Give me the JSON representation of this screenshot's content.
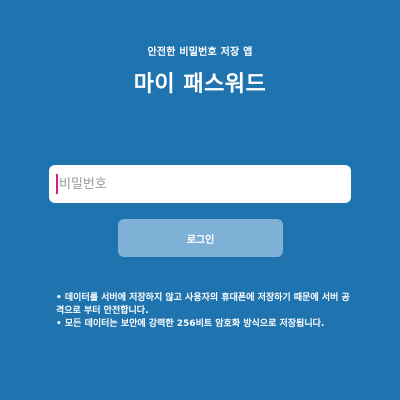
{
  "header": {
    "subtitle": "안전한 비밀번호 저장 앱",
    "title": "마이 패스워드"
  },
  "login": {
    "password_placeholder": "비밀번호",
    "password_value": "",
    "login_label": "로그인"
  },
  "notes": [
    "• 데이터를 서버에 저장하지 않고 사용자의 휴대폰에 저장하기 때문에 서버 공격으로 부터 안전합니다.",
    "• 모든 데이터는 보안에 강력한 256비트 암호화 방식으로 저장됩니다."
  ],
  "colors": {
    "background": "#1f73ae",
    "button": "#7fb1d7",
    "caret": "#d0227a"
  }
}
